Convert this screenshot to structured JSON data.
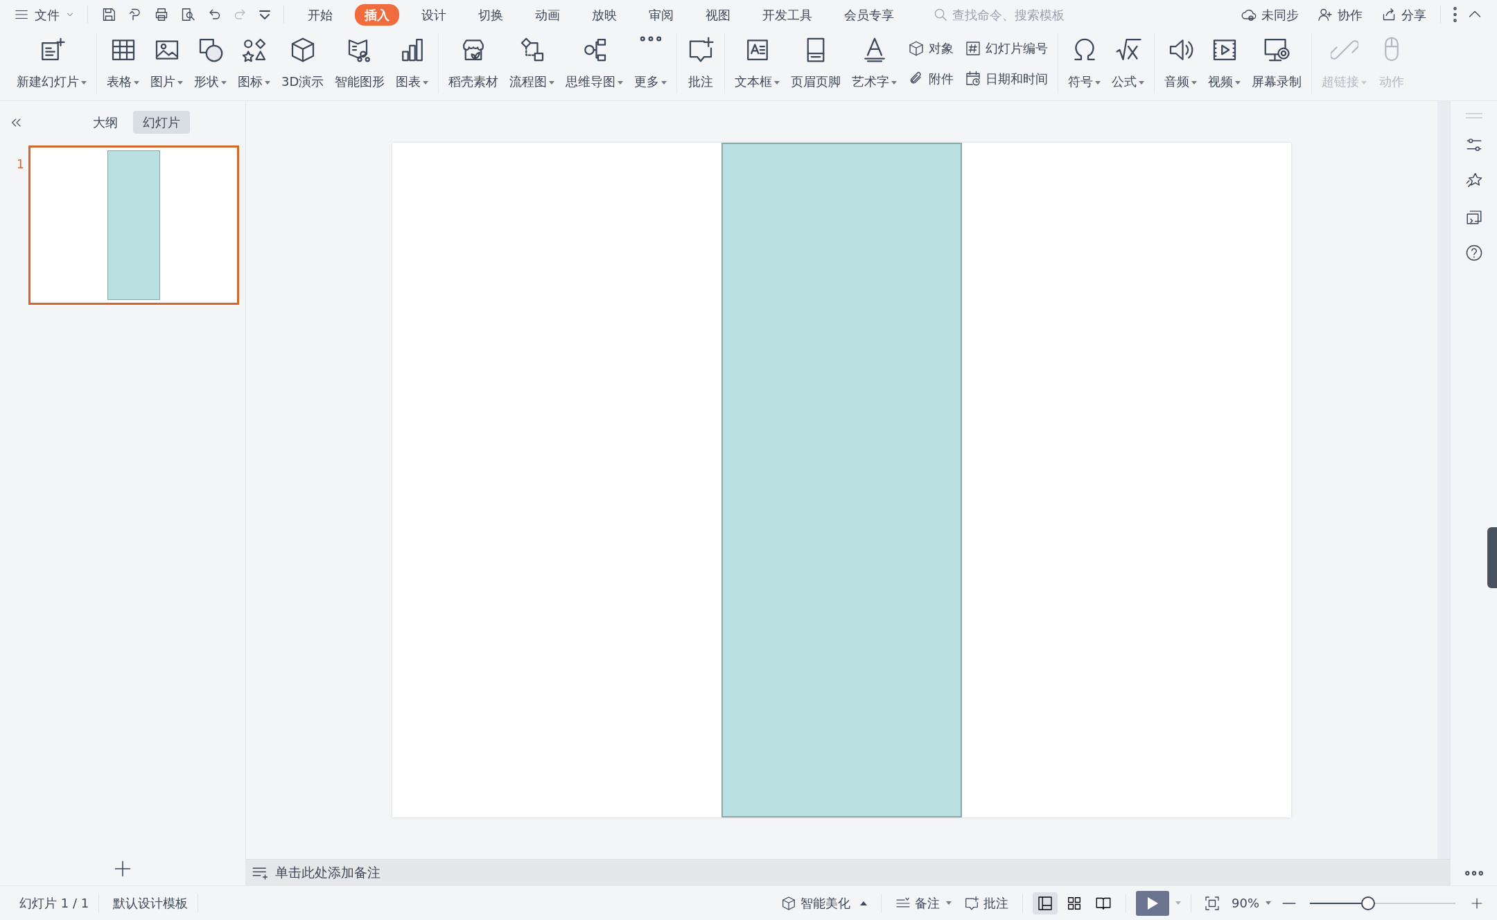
{
  "topbar": {
    "file_menu": "文件",
    "tabs": [
      {
        "label": "开始",
        "selected": false
      },
      {
        "label": "插入",
        "selected": true
      },
      {
        "label": "设计",
        "selected": false
      },
      {
        "label": "切换",
        "selected": false
      },
      {
        "label": "动画",
        "selected": false
      },
      {
        "label": "放映",
        "selected": false
      },
      {
        "label": "审阅",
        "selected": false
      },
      {
        "label": "视图",
        "selected": false
      },
      {
        "label": "开发工具",
        "selected": false
      },
      {
        "label": "会员专享",
        "selected": false
      }
    ],
    "search": {
      "placeholder": "查找命令、搜索模板"
    },
    "actions": [
      "未同步",
      "协作",
      "分享"
    ]
  },
  "ribbon": {
    "groups": [
      {
        "items": [
          {
            "label": "新建幻灯片",
            "kind": "large",
            "dropdown": true,
            "disabled": false
          }
        ]
      },
      {
        "items": [
          {
            "label": "表格",
            "kind": "large",
            "dropdown": true,
            "disabled": false
          },
          {
            "label": "图片",
            "kind": "large",
            "dropdown": true,
            "disabled": false
          },
          {
            "label": "形状",
            "kind": "large",
            "dropdown": true,
            "disabled": false
          },
          {
            "label": "图标",
            "kind": "large",
            "dropdown": true,
            "disabled": false
          },
          {
            "label": "3D演示",
            "kind": "large",
            "dropdown": false,
            "disabled": false
          },
          {
            "label": "智能图形",
            "kind": "large",
            "dropdown": false,
            "disabled": false
          },
          {
            "label": "图表",
            "kind": "large",
            "dropdown": true,
            "disabled": false
          }
        ]
      },
      {
        "items": [
          {
            "label": "稻壳素材",
            "kind": "large",
            "dropdown": false,
            "disabled": false
          },
          {
            "label": "流程图",
            "kind": "large",
            "dropdown": true,
            "disabled": false
          },
          {
            "label": "思维导图",
            "kind": "large",
            "dropdown": true,
            "disabled": false
          },
          {
            "label": "更多",
            "kind": "large",
            "dropdown": true,
            "disabled": false
          }
        ]
      },
      {
        "items": [
          {
            "label": "批注",
            "kind": "large",
            "dropdown": false,
            "disabled": false
          }
        ]
      },
      {
        "items": [
          {
            "label": "文本框",
            "kind": "large",
            "dropdown": true,
            "disabled": false
          },
          {
            "label": "页眉页脚",
            "kind": "large",
            "dropdown": false,
            "disabled": false
          },
          {
            "label": "艺术字",
            "kind": "large",
            "dropdown": true,
            "disabled": false
          },
          {
            "label": "对象",
            "kind": "small",
            "dropdown": false,
            "disabled": false
          },
          {
            "label": "附件",
            "kind": "small",
            "dropdown": false,
            "disabled": false
          },
          {
            "label": "幻灯片编号",
            "kind": "small",
            "dropdown": false,
            "disabled": false
          },
          {
            "label": "日期和时间",
            "kind": "small",
            "dropdown": false,
            "disabled": false
          }
        ]
      },
      {
        "items": [
          {
            "label": "符号",
            "kind": "large",
            "dropdown": true,
            "disabled": false
          },
          {
            "label": "公式",
            "kind": "large",
            "dropdown": true,
            "disabled": false
          }
        ]
      },
      {
        "items": [
          {
            "label": "音频",
            "kind": "large",
            "dropdown": true,
            "disabled": false
          },
          {
            "label": "视频",
            "kind": "large",
            "dropdown": true,
            "disabled": false
          },
          {
            "label": "屏幕录制",
            "kind": "large",
            "dropdown": false,
            "disabled": false
          }
        ]
      },
      {
        "items": [
          {
            "label": "超链接",
            "kind": "large",
            "dropdown": true,
            "disabled": true
          },
          {
            "label": "动作",
            "kind": "large",
            "dropdown": false,
            "disabled": true
          }
        ]
      }
    ]
  },
  "side_panel": {
    "tabs": [
      {
        "label": "大纲",
        "selected": false
      },
      {
        "label": "幻灯片",
        "selected": true
      }
    ],
    "slides": [
      {
        "number": "1",
        "selected": true
      }
    ]
  },
  "notes": {
    "placeholder": "单击此处添加备注"
  },
  "status_bar": {
    "slide_counter": "幻灯片 1 / 1",
    "template": "默认设计模板",
    "beautify": "智能美化",
    "notes": "备注",
    "comments": "批注",
    "views": [
      {
        "selected": true
      },
      {
        "selected": false
      },
      {
        "selected": false
      }
    ],
    "zoom": "90%",
    "zoom_slider": {
      "level": 0.4
    }
  }
}
